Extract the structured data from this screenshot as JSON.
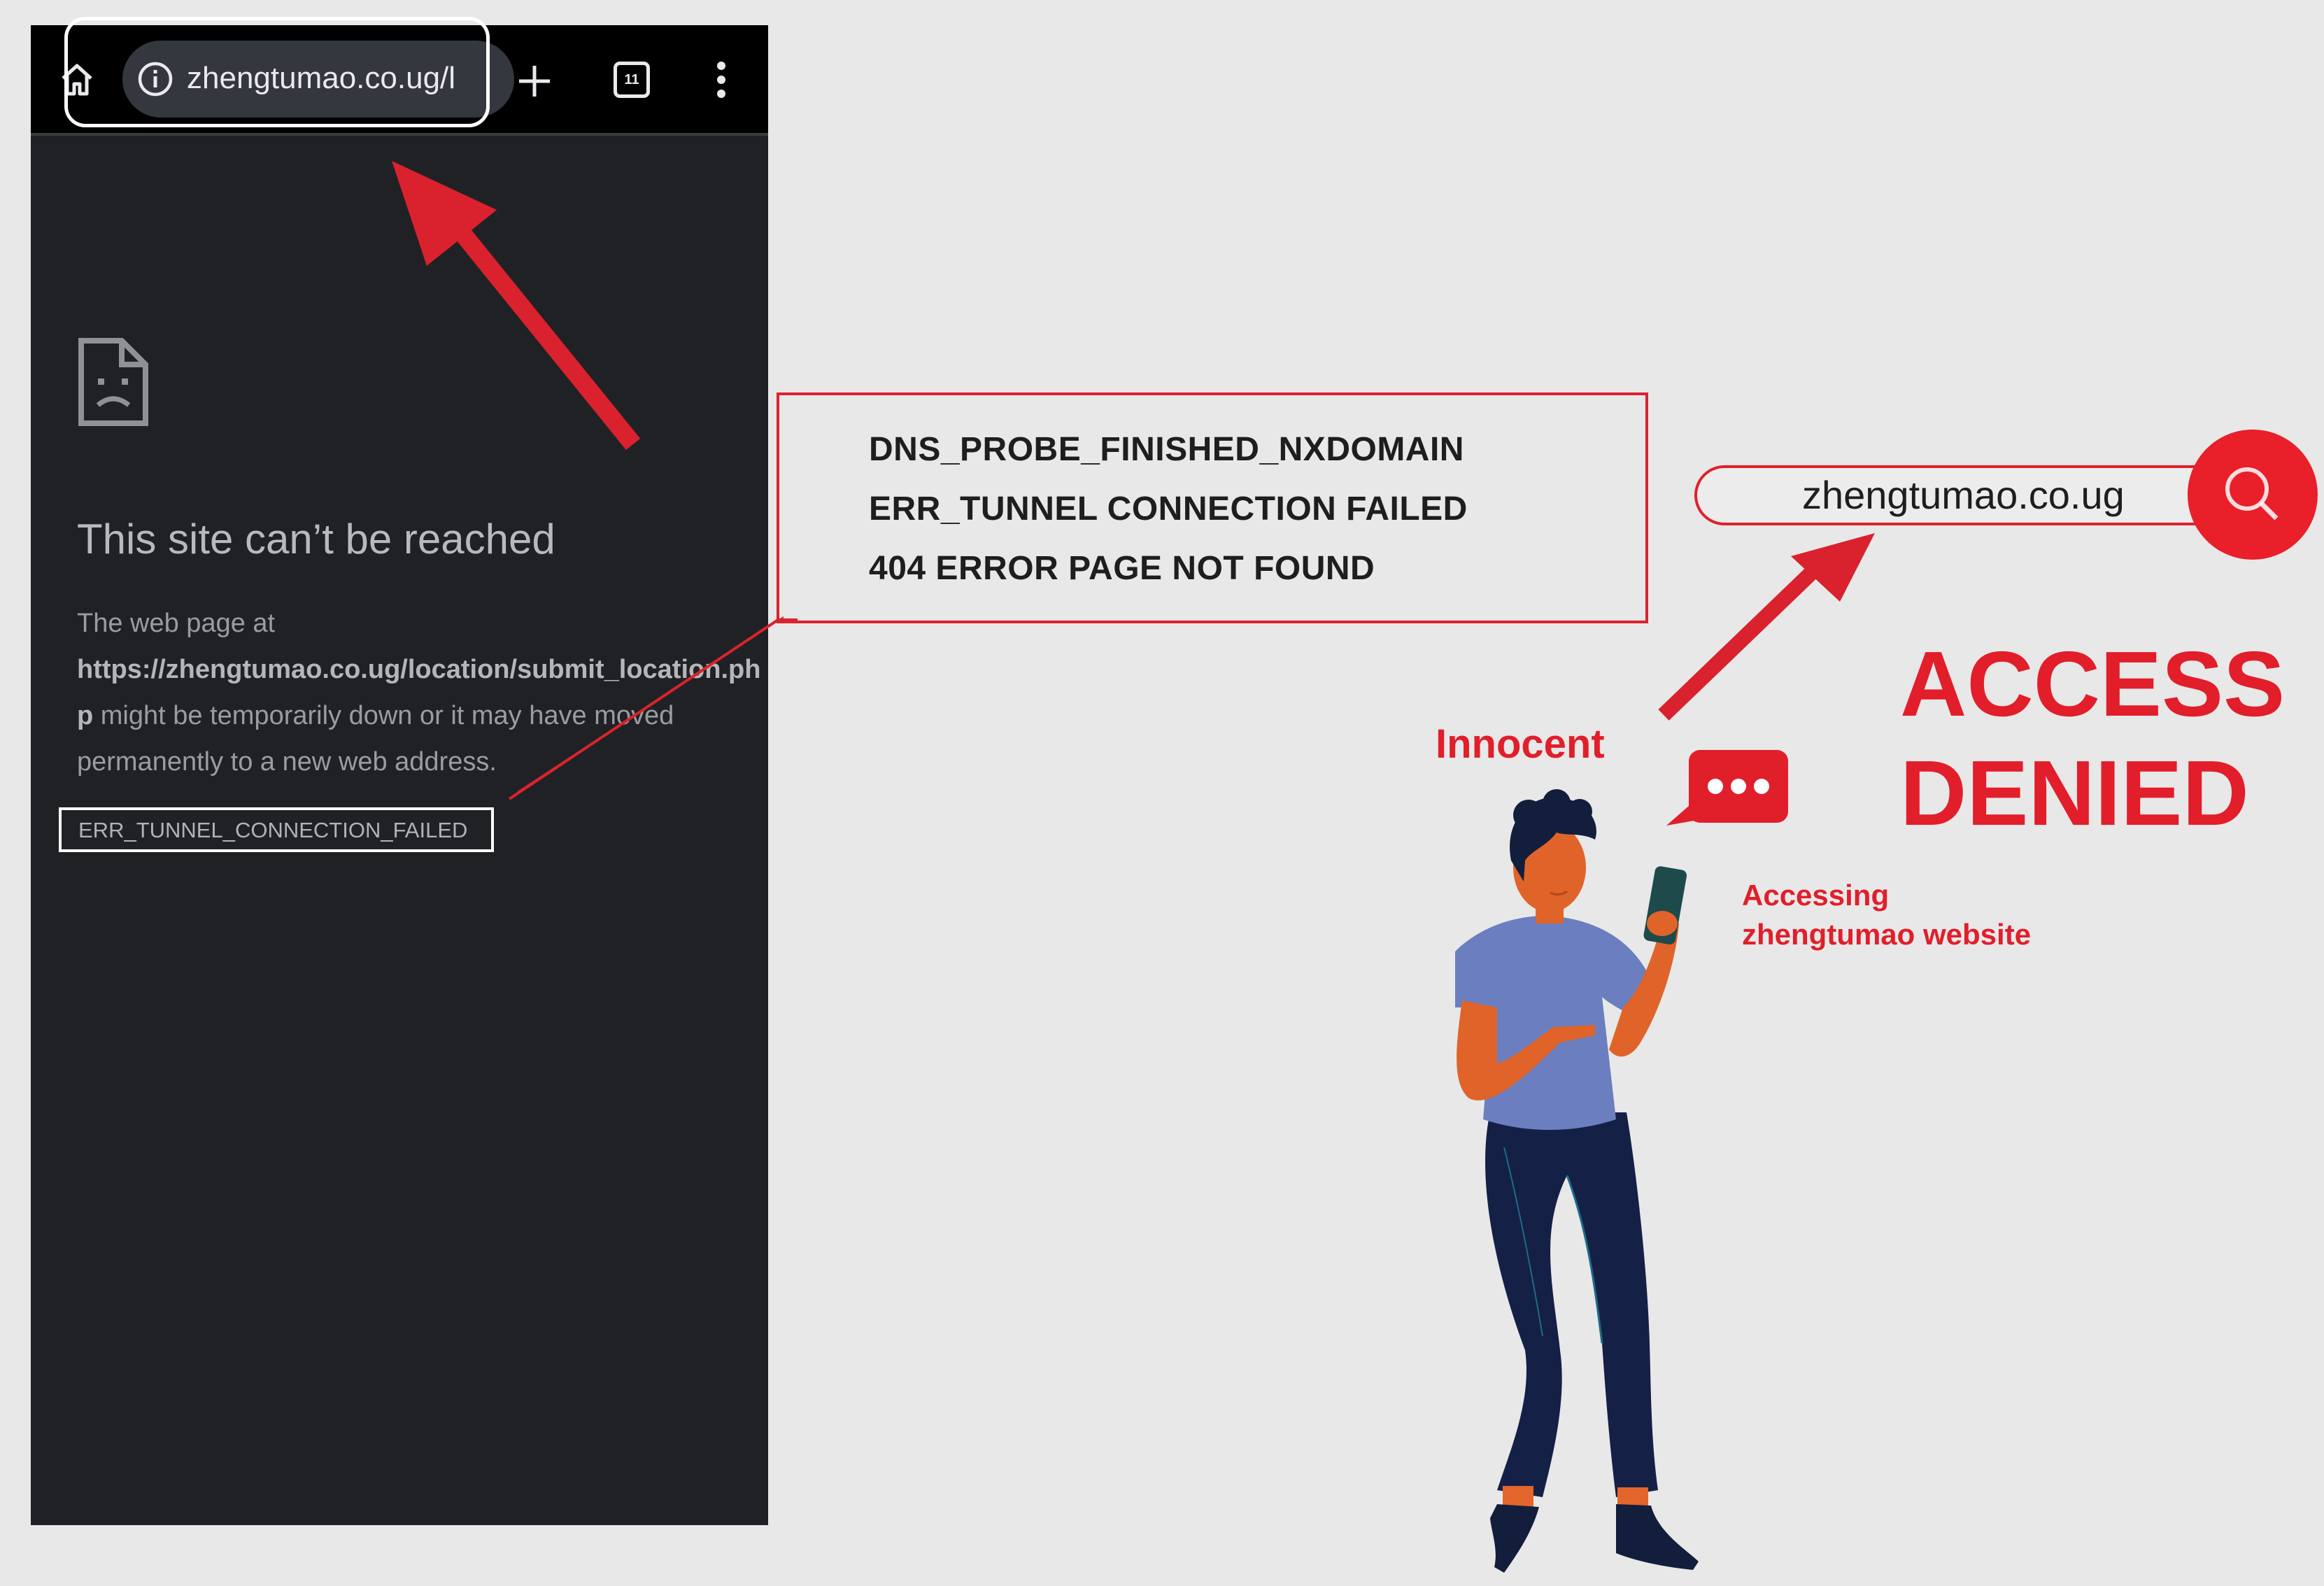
{
  "browser": {
    "url_short": "zhengtumao.co.ug/l",
    "tab_count": "11",
    "icons": [
      "home-icon",
      "info-icon",
      "new-tab-icon",
      "tabs-icon",
      "more-vert-icon"
    ]
  },
  "error_page": {
    "title": "This site can’t be reached",
    "body_prefix": "The web page at",
    "body_url": "https://zhengtumao.co.ug/location/submit_location.php",
    "body_suffix": "might be temporarily down or it may have moved permanently to a new web address.",
    "error_code": "ERR_TUNNEL_CONNECTION_FAILED"
  },
  "callout": {
    "lines": [
      "DNS_PROBE_FINISHED_NXDOMAIN",
      "ERR_TUNNEL CONNECTION FAILED",
      "404 ERROR PAGE NOT FOUND"
    ]
  },
  "search": {
    "query": "zhengtumao.co.ug"
  },
  "labels": {
    "access_line1": "ACCESS",
    "access_line2": "DENIED",
    "innocent": "Innocent",
    "accessing_line1": "Accessing",
    "accessing_line2": "zhengtumao website"
  },
  "colors": {
    "accent_red": "#e11e2a",
    "page_bg": "#202125",
    "toolbar_bg": "#000000",
    "canvas_bg": "#e8e8e8"
  }
}
